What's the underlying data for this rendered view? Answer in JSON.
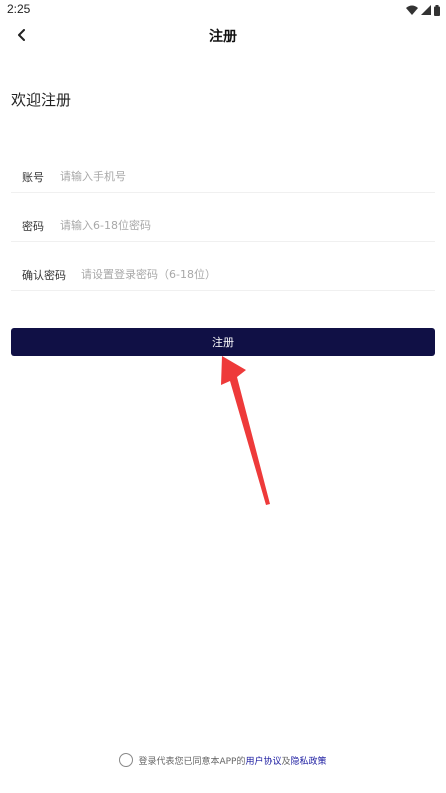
{
  "status_bar": {
    "time": "2:25",
    "icons": [
      "wifi-icon",
      "signal-icon",
      "battery-icon"
    ]
  },
  "nav": {
    "title": "注册",
    "back_icon": "chevron-left-icon"
  },
  "welcome": "欢迎注册",
  "form": {
    "account": {
      "label": "账号",
      "placeholder": "请输入手机号",
      "value": ""
    },
    "password": {
      "label": "密码",
      "placeholder": "请输入6-18位密码",
      "value": ""
    },
    "confirm": {
      "label": "确认密码",
      "placeholder": "请设置登录密码（6-18位）",
      "value": ""
    }
  },
  "register_button": "注册",
  "agreement": {
    "prefix": "登录代表您已同意本APP的",
    "user_agreement": "用户协议",
    "and": "及",
    "privacy_policy": "隐私政策"
  },
  "colors": {
    "button_bg": "#101045",
    "link": "#1a1aa0",
    "arrow": "#ee3a3a"
  }
}
